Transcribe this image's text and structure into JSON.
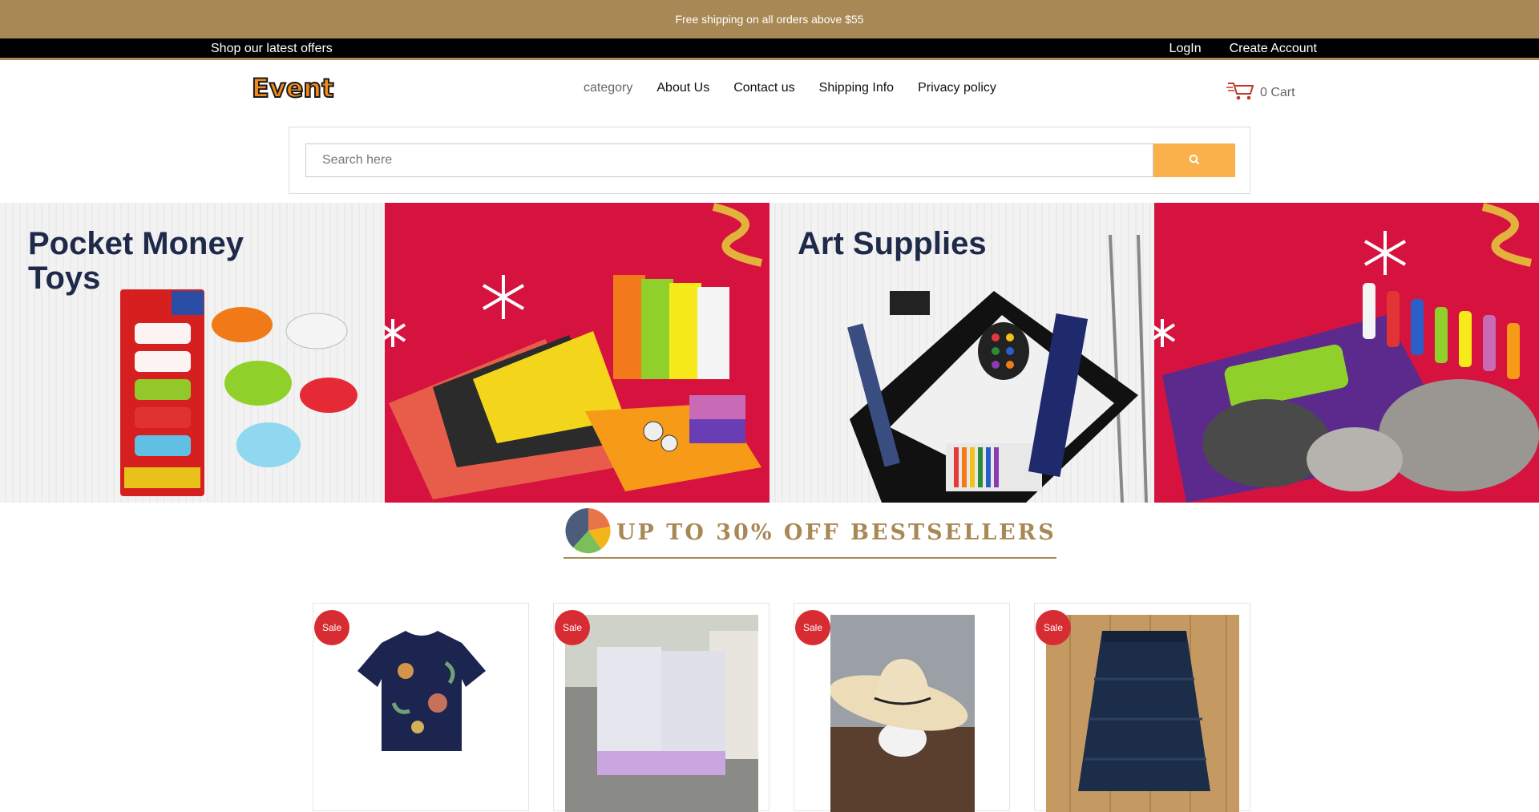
{
  "promo": {
    "text": "Free shipping on all orders above $55"
  },
  "topbar": {
    "offers": "Shop our latest offers",
    "login": "LogIn",
    "create_account": "Create Account"
  },
  "header": {
    "logo_text": "Event",
    "nav": [
      "category",
      "About Us",
      "Contact us",
      "Shipping Info",
      "Privacy policy"
    ],
    "cart_label": "0 Cart"
  },
  "search": {
    "placeholder": "Search here",
    "icon": "search-icon"
  },
  "banners": [
    {
      "title": "Pocket Money Toys"
    },
    {
      "title": "Art Supplies"
    }
  ],
  "section": {
    "title": "UP TO 30% OFF BESTSELLERS"
  },
  "products": [
    {
      "badge": "Sale",
      "image": "floral-shirt"
    },
    {
      "badge": "Sale",
      "image": "mattresses"
    },
    {
      "badge": "Sale",
      "image": "cowboy-hat"
    },
    {
      "badge": "Sale",
      "image": "navy-skirt"
    }
  ],
  "colors": {
    "brand_gold": "#a88854",
    "search_button": "#fbb14b",
    "banner_red": "#d6133f",
    "sale_red": "#d72d32",
    "banner_text": "#1f2a4a"
  }
}
